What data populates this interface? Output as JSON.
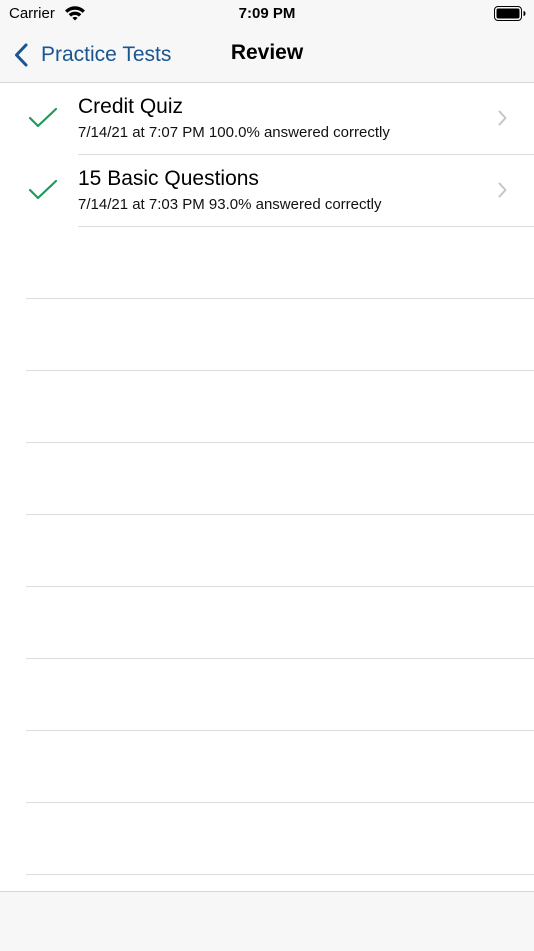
{
  "status_bar": {
    "carrier": "Carrier",
    "time": "7:09 PM",
    "wifi_icon": "wifi-icon",
    "battery_icon": "battery-icon"
  },
  "nav_bar": {
    "back_label": "Practice Tests",
    "back_icon": "chevron-left-icon",
    "title": "Review"
  },
  "colors": {
    "accent": "#1a5591",
    "check": "#1d9a5c",
    "chevron": "#c4c4c9",
    "separator": "#dcdcdc",
    "bar_background": "#f7f7f7"
  },
  "results": [
    {
      "title": "Credit Quiz",
      "subtitle": "7/14/21 at 7:07 PM 100.0% answered correctly",
      "status_icon": "checkmark-icon",
      "disclosure_icon": "chevron-right-icon"
    },
    {
      "title": "15 Basic Questions",
      "subtitle": "7/14/21 at 7:03 PM 93.0% answered correctly",
      "status_icon": "checkmark-icon",
      "disclosure_icon": "chevron-right-icon"
    }
  ]
}
